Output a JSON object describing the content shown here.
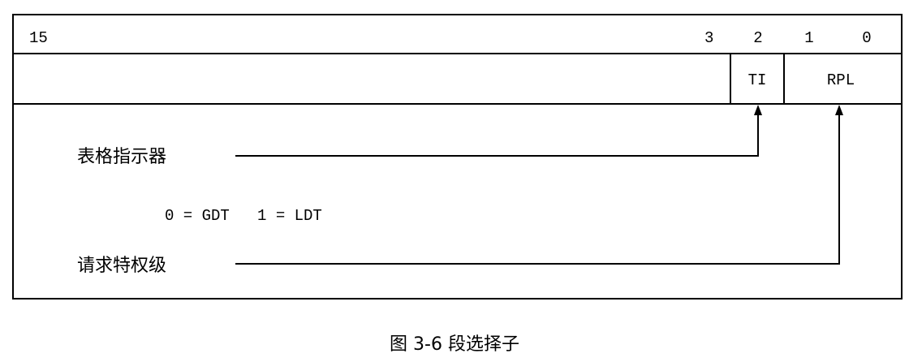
{
  "bit_labels": {
    "b15": "15",
    "b3": "3",
    "b2": "2",
    "b1": "1",
    "b0": "0"
  },
  "fields": {
    "ti": "TI",
    "rpl": "RPL"
  },
  "labels": {
    "table_indicator": "表格指示器",
    "ti_values": "0 = GDT   1 = LDT",
    "rpl": "请求特权级"
  },
  "caption": "图 3-6 段选择子"
}
